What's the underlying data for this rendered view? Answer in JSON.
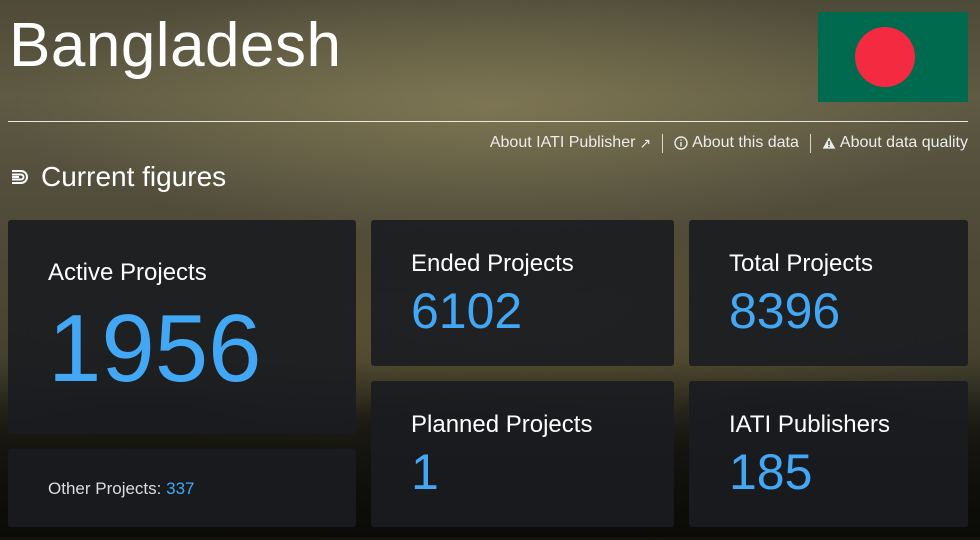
{
  "header": {
    "country": "Bangladesh",
    "flag": {
      "name": "bangladesh-flag",
      "field_color": "#006a4e",
      "disc_color": "#f42a41"
    }
  },
  "info_links": {
    "publisher": "About IATI Publisher",
    "publisher_icon": "external-link-icon",
    "this_data": "About this data",
    "this_data_icon": "info-icon",
    "data_quality": "About data quality",
    "data_quality_icon": "warning-icon"
  },
  "section": {
    "title": "Current figures",
    "icon": "figures-icon"
  },
  "colors": {
    "accent": "#42a8f5",
    "card_bg": "#1a1c20"
  },
  "cards": {
    "active": {
      "label": "Active Projects",
      "value": "1956"
    },
    "other": {
      "label": "Other Projects:",
      "value": "337"
    },
    "ended": {
      "label": "Ended Projects",
      "value": "6102"
    },
    "total": {
      "label": "Total Projects",
      "value": "8396"
    },
    "planned": {
      "label": "Planned Projects",
      "value": "1"
    },
    "publishers": {
      "label": "IATI Publishers",
      "value": "185"
    }
  }
}
